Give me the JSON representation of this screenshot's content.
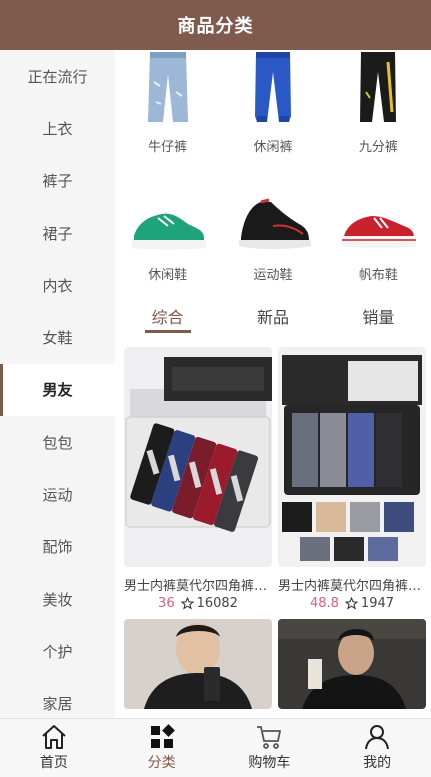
{
  "header": {
    "title": "商品分类"
  },
  "sidebar": {
    "items": [
      {
        "label": "正在流行"
      },
      {
        "label": "上衣"
      },
      {
        "label": "裤子"
      },
      {
        "label": "裙子"
      },
      {
        "label": "内衣"
      },
      {
        "label": "女鞋"
      },
      {
        "label": "男友",
        "active": true
      },
      {
        "label": "包包"
      },
      {
        "label": "运动"
      },
      {
        "label": "配饰"
      },
      {
        "label": "美妆"
      },
      {
        "label": "个护"
      },
      {
        "label": "家居"
      }
    ]
  },
  "subcategories": [
    {
      "label": "牛仔裤",
      "icon": "jeans"
    },
    {
      "label": "休闲裤",
      "icon": "blue-joggers"
    },
    {
      "label": "九分裤",
      "icon": "black-pants"
    },
    {
      "label": "休闲鞋",
      "icon": "green-sneaker"
    },
    {
      "label": "运动鞋",
      "icon": "black-running-shoe"
    },
    {
      "label": "帆布鞋",
      "icon": "red-canvas-shoe"
    }
  ],
  "sort_tabs": [
    {
      "label": "综合",
      "active": true
    },
    {
      "label": "新品"
    },
    {
      "label": "销量"
    }
  ],
  "products": [
    {
      "name": "男士内裤莫代尔四角裤男平角裤",
      "price": "36",
      "sales": "16082"
    },
    {
      "name": "男士内裤莫代尔四角裤男平角裤",
      "price": "48.8",
      "sales": "1947"
    },
    {
      "name": "",
      "price": "",
      "sales": ""
    },
    {
      "name": "",
      "price": "",
      "sales": ""
    }
  ],
  "tabbar": [
    {
      "label": "首页",
      "icon": "home-icon"
    },
    {
      "label": "分类",
      "icon": "category-icon",
      "active": true
    },
    {
      "label": "购物车",
      "icon": "cart-icon"
    },
    {
      "label": "我的",
      "icon": "user-icon"
    }
  ],
  "colors": {
    "brand": "#7f5b4e",
    "price": "#e35d7b",
    "sidebar_bg": "#f5f5f5"
  }
}
